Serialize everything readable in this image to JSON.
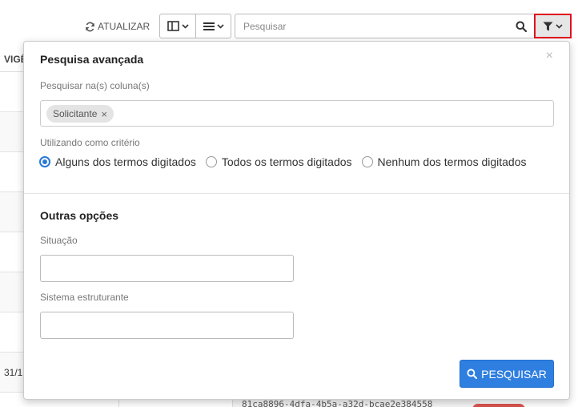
{
  "toolbar": {
    "refresh_label": "ATUALIZAR",
    "search_placeholder": "Pesquisar",
    "search_value": ""
  },
  "table_bg": {
    "header_fragment": "VIGÊ",
    "cell_fragment": "31/1",
    "uuid_fragment": "81ca8896-4dfa-4b5a-a32d-bcae2e384558"
  },
  "popover": {
    "title": "Pesquisa avançada",
    "columns_label": "Pesquisar na(s) coluna(s)",
    "column_tags": [
      {
        "label": "Solicitante",
        "remove": "×"
      }
    ],
    "criteria_label": "Utilizando como critério",
    "criteria_options": [
      {
        "label": "Alguns dos termos digitados",
        "selected": true
      },
      {
        "label": "Todos os termos digitados",
        "selected": false
      },
      {
        "label": "Nenhum dos termos digitados",
        "selected": false
      }
    ],
    "other_title": "Outras opções",
    "situacao_label": "Situação",
    "situacao_value": "",
    "sistema_label": "Sistema estruturante",
    "sistema_value": "",
    "submit_label": "PESQUISAR",
    "close_glyph": "×"
  },
  "colors": {
    "primary": "#2f7fe0",
    "radio_selected": "#2a79d6",
    "filter_highlight_border": "#e0101e",
    "status_pill": "#d9534f"
  },
  "icons": {
    "refresh": "refresh-icon",
    "columns": "columns-icon",
    "list": "list-icon",
    "search": "search-icon",
    "filter": "filter-icon",
    "chevron": "chevron-down-icon"
  }
}
